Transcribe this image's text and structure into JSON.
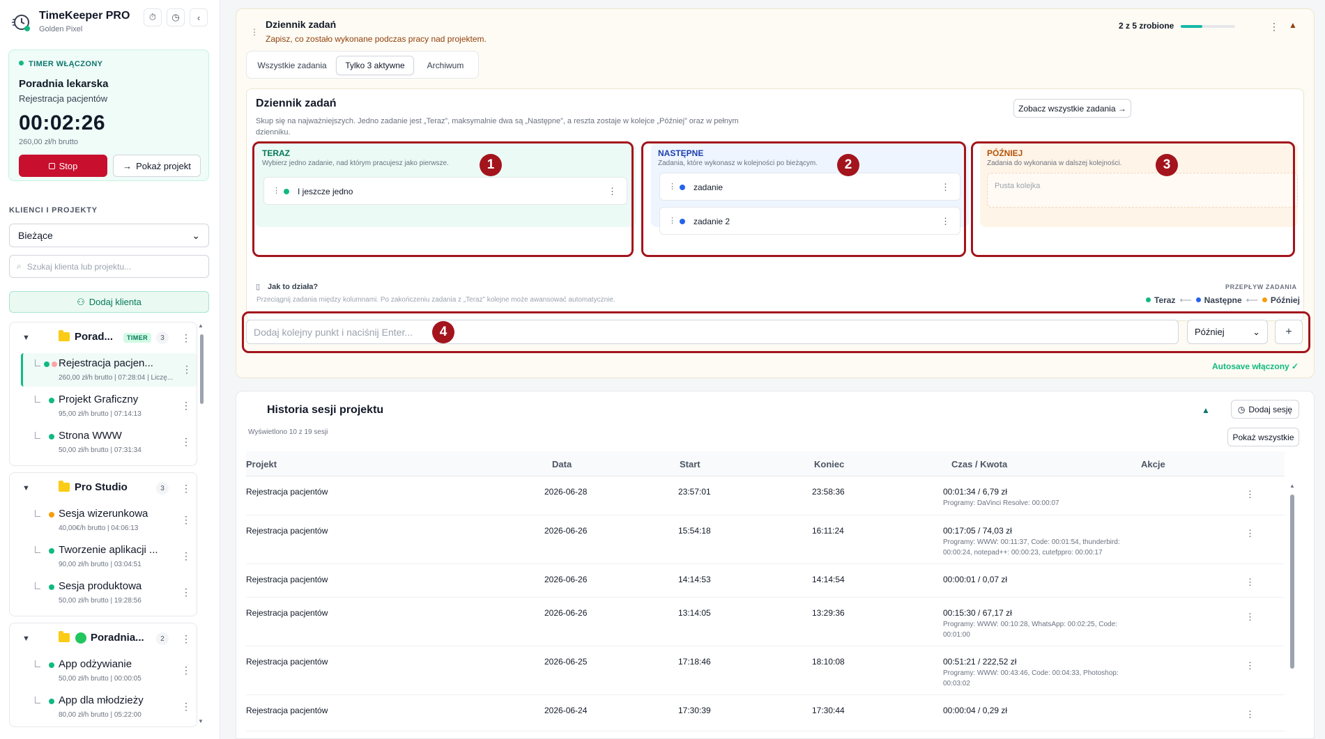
{
  "app": {
    "title": "TimeKeeper PRO",
    "subtitle": "Golden Pixel"
  },
  "timer": {
    "badge": "TIMER WŁĄCZONY",
    "client": "Poradnia lekarska",
    "project": "Rejestracja pacjentów",
    "time": "00:02:26",
    "rate": "260,00 zł/h brutto",
    "stop_label": "Stop",
    "show_project_label": "Pokaż projekt"
  },
  "sidebar": {
    "section_label": "KLIENCI I PROJEKTY",
    "filter_value": "Bieżące",
    "search_placeholder": "Szukaj klienta lub projektu...",
    "add_client_label": "Dodaj klienta",
    "groups": [
      {
        "name": "Porad...",
        "timer_badge": "TIMER",
        "count": "3",
        "items": [
          {
            "name": "Rejestracja pacjen...",
            "meta": "260,00 zł/h brutto | 07:28:04 | Liczę...",
            "dot": "#10b981"
          },
          {
            "name": "Projekt Graficzny",
            "meta": "95,00 zł/h brutto | 07:14:13",
            "dot": "#10b981"
          },
          {
            "name": "Strona WWW",
            "meta": "50,00 zł/h brutto | 07:31:34",
            "dot": "#10b981"
          }
        ]
      },
      {
        "name": "Pro Studio",
        "count": "3",
        "items": [
          {
            "name": "Sesja wizerunkowa",
            "meta": "40,00€/h brutto | 04:06:13",
            "dot": "#f59e0b"
          },
          {
            "name": "Tworzenie aplikacji ...",
            "meta": "90,00 zł/h brutto | 03:04:51",
            "dot": "#10b981"
          },
          {
            "name": "Sesja produktowa",
            "meta": "50,00 zł/h brutto | 19:28:56",
            "dot": "#10b981"
          }
        ]
      },
      {
        "name": "Poradnia...",
        "count": "2",
        "items": [
          {
            "name": "App odżywianie",
            "meta": "50,00 zł/h brutto | 00:00:05",
            "dot": "#10b981"
          },
          {
            "name": "App dla młodzieży",
            "meta": "80,00 zł/h brutto | 05:22:00",
            "dot": "#10b981"
          }
        ]
      }
    ]
  },
  "tasks_panel": {
    "title": "Dziennik zadań",
    "subtitle": "Zapisz, co zostało wykonane podczas pracy nad projektem.",
    "progress_label": "2 z 5 zrobione",
    "progress_fraction": 0.4,
    "tabs": [
      "Wszystkie zadania",
      "Tylko 3 aktywne",
      "Archiwum"
    ],
    "board": {
      "title": "Dziennik zadań",
      "description": "Skup się na najważniejszych. Jedno zadanie jest „Teraz”, maksymalnie dwa są „Następne”, a reszta zostaje w kolejce „Później” oraz w pełnym dzienniku.",
      "see_all_label": "Zobacz wszystkie zadania →",
      "columns": [
        {
          "title": "TERAZ",
          "desc": "Wybierz jedno zadanie, nad którym pracujesz jako pierwsze.",
          "tasks": [
            "I jeszcze jedno"
          ]
        },
        {
          "title": "NASTĘPNE",
          "desc": "Zadania, które wykonasz w kolejności po bieżącym.",
          "tasks": [
            "zadanie",
            "zadanie 2"
          ]
        },
        {
          "title": "PÓŹNIEJ",
          "desc": "Zadania do wykonania w dalszej kolejności.",
          "empty": "Pusta kolejka"
        }
      ],
      "how_title": "Jak to działa?",
      "how_desc": "Przeciągnij zadania między kolumnami. Po zakończeniu zadania z „Teraz” kolejne może awansować automatycznie.",
      "flow_label": "PRZEPŁYW ZADANIA",
      "flow": [
        "Teraz",
        "Następne",
        "Później"
      ],
      "flow_arrow": "⟵"
    },
    "add_placeholder": "Dodaj kolejny punkt i naciśnij Enter...",
    "add_select_value": "Później",
    "add_plus": "+",
    "autosave": "Autosave włączony ✓",
    "annotations": [
      "1",
      "2",
      "3",
      "4"
    ]
  },
  "history": {
    "title": "Historia sesji projektu",
    "add_session_label": "Dodaj sesję",
    "count_label": "Wyświetlono 10 z 19 sesji",
    "show_all_label": "Pokaż wszystkie",
    "columns": [
      "Projekt",
      "Data",
      "Start",
      "Koniec",
      "Czas / Kwota",
      "Akcje"
    ],
    "rows": [
      {
        "project": "Rejestracja pacjentów",
        "date": "2026-06-28",
        "start": "23:57:01",
        "end": "23:58:36",
        "amount": "00:01:34 / 6,79 zł",
        "programs": "Programy: DaVinci Resolve: 00:00:07"
      },
      {
        "project": "Rejestracja pacjentów",
        "date": "2026-06-26",
        "start": "15:54:18",
        "end": "16:11:24",
        "amount": "00:17:05 / 74,03 zł",
        "programs": "Programy: WWW: 00:11:37, Code: 00:01:54, thunderbird: 00:00:24, notepad++: 00:00:23, cutefppro: 00:00:17"
      },
      {
        "project": "Rejestracja pacjentów",
        "date": "2026-06-26",
        "start": "14:14:53",
        "end": "14:14:54",
        "amount": "00:00:01 / 0,07 zł",
        "programs": ""
      },
      {
        "project": "Rejestracja pacjentów",
        "date": "2026-06-26",
        "start": "13:14:05",
        "end": "13:29:36",
        "amount": "00:15:30 / 67,17 zł",
        "programs": "Programy: WWW: 00:10:28, WhatsApp: 00:02:25, Code: 00:01:00"
      },
      {
        "project": "Rejestracja pacjentów",
        "date": "2026-06-25",
        "start": "17:18:46",
        "end": "18:10:08",
        "amount": "00:51:21 / 222,52 zł",
        "programs": "Programy: WWW: 00:43:46, Code: 00:04:33, Photoshop: 00:03:02"
      },
      {
        "project": "Rejestracja pacjentów",
        "date": "2026-06-24",
        "start": "17:30:39",
        "end": "17:30:44",
        "amount": "00:00:04 / 0,29 zł",
        "programs": ""
      }
    ]
  }
}
